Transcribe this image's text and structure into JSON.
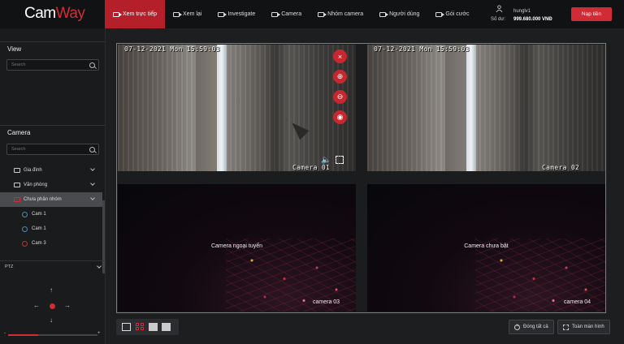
{
  "app": {
    "logo_text": "CamWay",
    "logo_accent": "#d12b35",
    "brand_color": "#b51f2a"
  },
  "nav": {
    "items": [
      {
        "label": "Xem trực tiếp",
        "icon": "video-camera-icon",
        "active": true
      },
      {
        "label": "Xem lại",
        "icon": "video-camera-icon",
        "active": false
      },
      {
        "label": "Investigate",
        "icon": "video-camera-icon",
        "active": false
      },
      {
        "label": "Camera",
        "icon": "video-camera-icon",
        "active": false
      },
      {
        "label": "Nhóm camera",
        "icon": "video-camera-icon",
        "active": false
      },
      {
        "label": "Người dùng",
        "icon": "video-camera-icon",
        "active": false
      },
      {
        "label": "Gói cước",
        "icon": "video-camera-icon",
        "active": false
      }
    ]
  },
  "user": {
    "name": "hunglv1",
    "balance_label": "Số dư:",
    "balance": "999.680.000 VNĐ",
    "topup_label": "Nạp tiền"
  },
  "sidebar": {
    "view_title": "View",
    "view_search_placeholder": "Search",
    "camera_title": "Camera",
    "camera_search_placeholder": "Search",
    "groups": [
      {
        "label": "Gia đình",
        "expanded": false
      },
      {
        "label": "Văn phòng",
        "expanded": false
      },
      {
        "label": "Chưa phân nhóm",
        "expanded": true
      }
    ],
    "cameras": [
      {
        "label": "Cam 1",
        "status": "online"
      },
      {
        "label": "Cam 1",
        "status": "online"
      },
      {
        "label": "Cam 3",
        "status": "offline"
      }
    ],
    "ptz_label": "PTZ",
    "zoom_minus": "-",
    "zoom_plus": "+",
    "zoom_level": 0.34
  },
  "grid": {
    "tiles": [
      {
        "timestamp": "07-12-2021 Mon 15:59:03",
        "name": "Camera 01",
        "state": "live",
        "selected": true
      },
      {
        "timestamp": "07-12-2021 Mon 15:59:03",
        "name": "Camera 02",
        "state": "live",
        "selected": false
      },
      {
        "message": "Camera ngoại tuyến",
        "name": "camera 03",
        "state": "offline"
      },
      {
        "message": "Camera chưa bật",
        "name": "camera 04",
        "state": "off"
      }
    ],
    "controls": [
      "close-icon",
      "zoom-in-icon",
      "zoom-out-icon",
      "snapshot-icon"
    ]
  },
  "toolbar": {
    "layouts": [
      "1x1",
      "2x2",
      "3x3",
      "4x4"
    ],
    "active_layout": "2x2",
    "close_all_label": "Đóng tất cả",
    "fullscreen_label": "Toàn màn hình"
  }
}
